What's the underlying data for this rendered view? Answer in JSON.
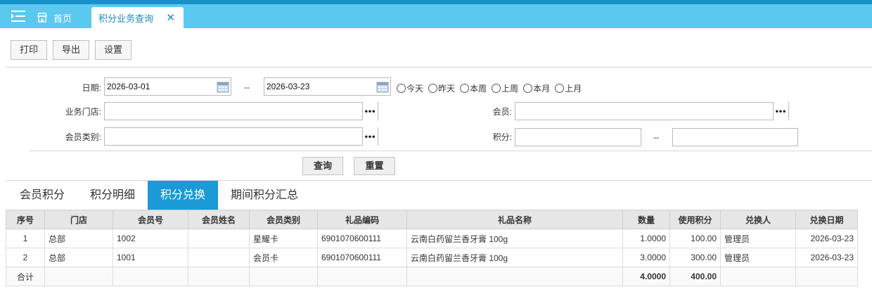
{
  "tabs": {
    "home_label": "首页",
    "active_label": "积分业务查询",
    "close_glyph": "✕"
  },
  "toolbar": {
    "print_label": "打印",
    "export_label": "导出",
    "settings_label": "设置"
  },
  "filters": {
    "date_label": "日期:",
    "date_from": "2026-03-01",
    "date_sep": "--",
    "date_to": "2026-03-23",
    "quick_ranges": [
      "今天",
      "昨天",
      "本周",
      "上周",
      "本月",
      "上月"
    ],
    "store_label": "业务门店:",
    "store_value": "",
    "member_label": "会员:",
    "member_value": "",
    "member_type_label": "会员类别:",
    "member_type_value": "",
    "points_label": "积分:",
    "points_from": "",
    "points_sep": "--",
    "points_to": "",
    "picker_glyph": "•••",
    "query_label": "查询",
    "reset_label": "重置"
  },
  "result_tabs": [
    "会员积分",
    "积分明细",
    "积分兑换",
    "期间积分汇总"
  ],
  "active_result_tab": 2,
  "table": {
    "columns": [
      "序号",
      "门店",
      "会员号",
      "会员姓名",
      "会员类别",
      "礼品编码",
      "礼品名称",
      "数量",
      "使用积分",
      "兑换人",
      "兑换日期"
    ],
    "rows": [
      [
        "1",
        "总部",
        "1002",
        "",
        "星耀卡",
        "6901070600111",
        "云南白药留兰香牙膏 100g",
        "1.0000",
        "100.00",
        "管理员",
        "2026-03-23"
      ],
      [
        "2",
        "总部",
        "1001",
        "",
        "会员卡",
        "6901070600111",
        "云南白药留兰香牙膏 100g",
        "3.0000",
        "300.00",
        "管理员",
        "2026-03-23"
      ]
    ],
    "total_label": "合计",
    "total_qty": "4.0000",
    "total_points": "400.00"
  },
  "colors": {
    "topbar": "#5bc8f0",
    "topbar_dark": "#1890c8",
    "active_tab": "#1a9ad6"
  }
}
